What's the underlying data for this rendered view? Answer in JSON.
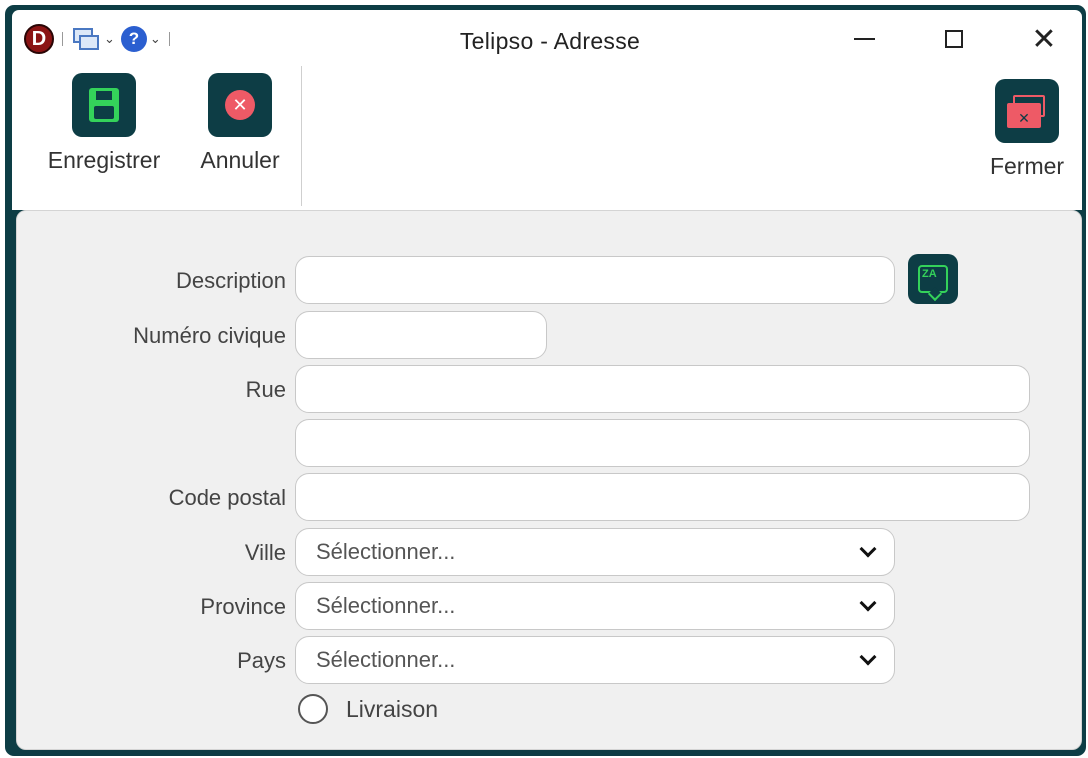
{
  "window": {
    "title": "Telipso - Adresse",
    "logo_letter": "D",
    "help_glyph": "?"
  },
  "toolbar": {
    "save_label": "Enregistrer",
    "cancel_label": "Annuler",
    "close_label": "Fermer"
  },
  "form": {
    "description": {
      "label": "Description",
      "value": ""
    },
    "civic_number": {
      "label": "Numéro civique",
      "value": ""
    },
    "street": {
      "label": "Rue",
      "value": ""
    },
    "street2": {
      "value": ""
    },
    "postal_code": {
      "label": "Code postal",
      "value": ""
    },
    "city": {
      "label": "Ville",
      "selected": "Sélectionner..."
    },
    "province": {
      "label": "Province",
      "selected": "Sélectionner..."
    },
    "country": {
      "label": "Pays",
      "selected": "Sélectionner..."
    },
    "delivery": {
      "label": "Livraison",
      "checked": false
    }
  },
  "colors": {
    "frame": "#0d3d45",
    "accent_green": "#34d25a",
    "accent_red": "#ee5a66",
    "panel_bg": "#f0f0f0"
  },
  "icons": {
    "logo": "d-logo-icon",
    "windows": "windows-icon",
    "help": "help-icon",
    "save": "floppy-disk-icon",
    "cancel": "cancel-circle-icon",
    "close_window": "close-window-icon",
    "translate": "translate-bubble-icon"
  }
}
